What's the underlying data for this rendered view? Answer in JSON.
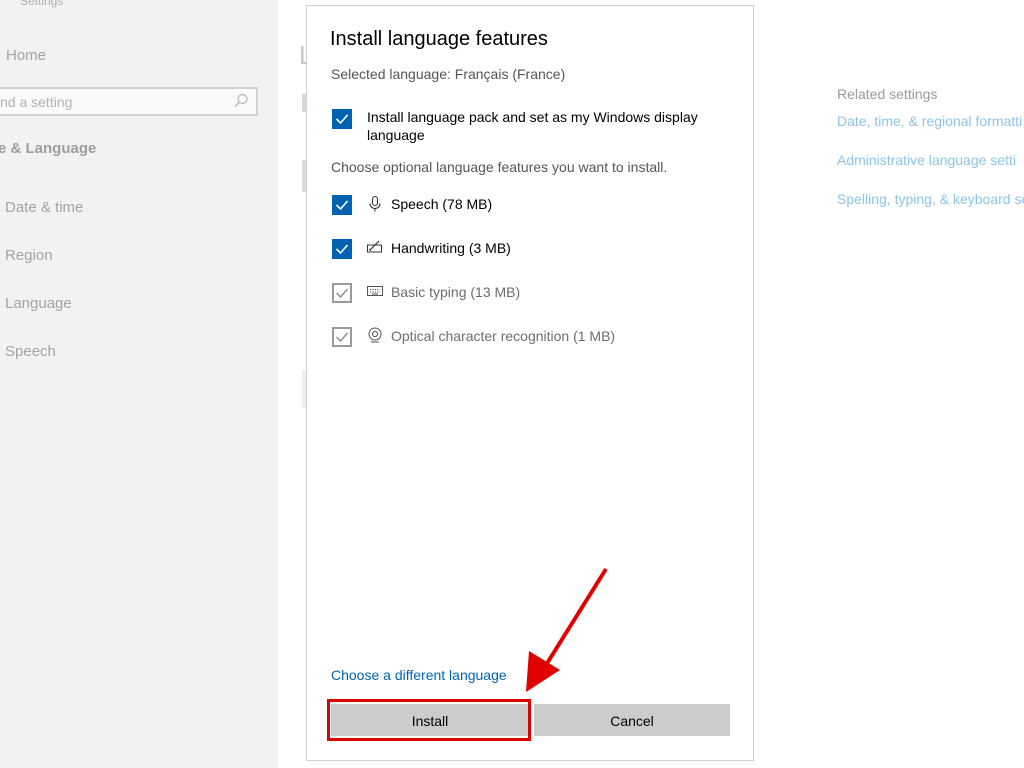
{
  "settings": {
    "app_title": "Settings",
    "home_label": "Home",
    "search_placeholder": "nd a setting",
    "section_title": "e & Language",
    "nav": [
      {
        "label": "Date & time"
      },
      {
        "label": "Region"
      },
      {
        "label": "Language"
      },
      {
        "label": "Speech"
      }
    ],
    "page_title_fragment": "L",
    "related": {
      "title": "Related settings",
      "links": [
        {
          "label": "Date, time, & regional formatti"
        },
        {
          "label": "Administrative language setti"
        },
        {
          "label": "Spelling, typing, & keyboard se"
        }
      ]
    }
  },
  "dialog": {
    "title": "Install language features",
    "selected_language": "Selected language: Français (France)",
    "main_option": {
      "label": "Install language pack and set as my Windows display language",
      "checked": true
    },
    "optional_intro": "Choose optional language features you want to install.",
    "features": [
      {
        "label": "Speech (78 MB)",
        "icon": "microphone-icon",
        "checked": true,
        "disabled": false
      },
      {
        "label": "Handwriting (3 MB)",
        "icon": "handwriting-pen-icon",
        "checked": true,
        "disabled": false
      },
      {
        "label": "Basic typing (13 MB)",
        "icon": "keyboard-icon",
        "checked": true,
        "disabled": true
      },
      {
        "label": "Optical character recognition (1 MB)",
        "icon": "ocr-camera-icon",
        "checked": true,
        "disabled": true
      }
    ],
    "different_language_link": "Choose a different language",
    "install_label": "Install",
    "cancel_label": "Cancel"
  },
  "colors": {
    "accent": "#0063b1",
    "annotation": "#e00000"
  }
}
